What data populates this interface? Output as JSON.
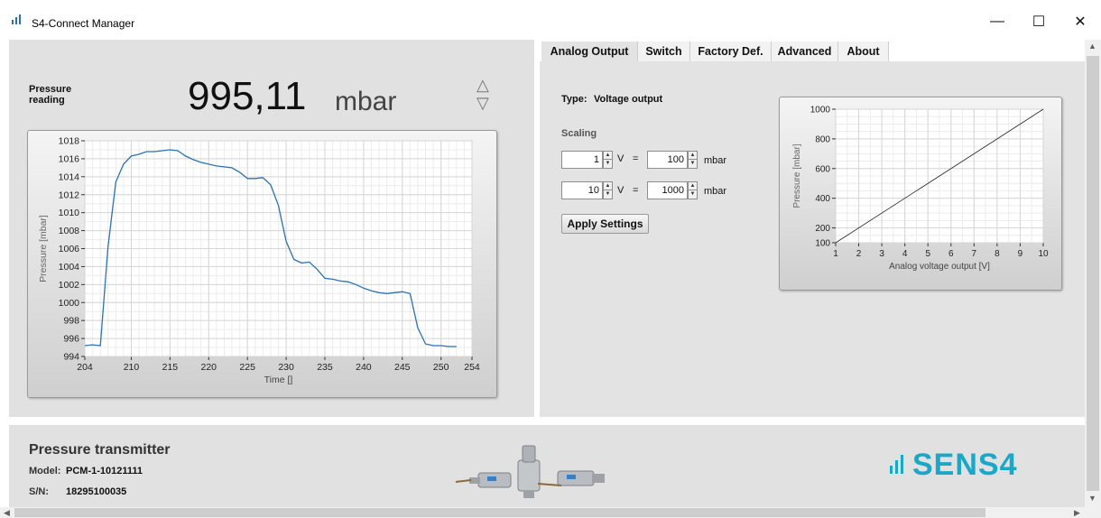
{
  "window": {
    "title": "S4-Connect Manager",
    "minimize": "—",
    "maximize": "☐",
    "close": "✕"
  },
  "reading": {
    "label": "Pressure reading",
    "value": "995,11",
    "unit": "mbar"
  },
  "tabs": [
    {
      "label": "Analog Output",
      "active": true
    },
    {
      "label": "Switch",
      "active": false
    },
    {
      "label": "Factory Def.",
      "active": false
    },
    {
      "label": "Advanced",
      "active": false
    },
    {
      "label": "About",
      "active": false
    }
  ],
  "analog_output": {
    "type_label": "Type:",
    "type_value": "Voltage output",
    "scaling_label": "Scaling",
    "rows": [
      {
        "voltage": "1",
        "v_unit": "V",
        "equals": "=",
        "pressure": "100",
        "p_unit": "mbar"
      },
      {
        "voltage": "10",
        "v_unit": "V",
        "equals": "=",
        "pressure": "1000",
        "p_unit": "mbar"
      }
    ],
    "apply_label": "Apply Settings"
  },
  "footer": {
    "title": "Pressure transmitter",
    "model_label": "Model:",
    "model_value": "PCM-1-10121111",
    "sn_label": "S/N:",
    "sn_value": "18295100035",
    "brand": "SENS4"
  },
  "colors": {
    "line": "#2a72b5",
    "brand": "#1aa8c8"
  },
  "chart_data": [
    {
      "type": "line",
      "xlabel": "Time []",
      "ylabel": "Pressure [mbar]",
      "xlim": [
        204,
        254
      ],
      "ylim": [
        994,
        1018
      ],
      "xticks": [
        204,
        210,
        215,
        220,
        225,
        230,
        235,
        240,
        245,
        250,
        254
      ],
      "yticks": [
        994,
        996,
        998,
        1000,
        1002,
        1004,
        1006,
        1008,
        1010,
        1012,
        1014,
        1016,
        1018
      ],
      "grid": true,
      "x": [
        204,
        205,
        206,
        207,
        208,
        209,
        210,
        211,
        212,
        213,
        214,
        215,
        216,
        217,
        218,
        219,
        220,
        221,
        222,
        223,
        224,
        225,
        226,
        227,
        228,
        229,
        230,
        231,
        232,
        233,
        234,
        235,
        236,
        237,
        238,
        239,
        240,
        241,
        242,
        243,
        244,
        245,
        246,
        247,
        248,
        249,
        250,
        251,
        252
      ],
      "y": [
        995.2,
        995.3,
        995.2,
        1006.2,
        1013.4,
        1015.4,
        1016.3,
        1016.5,
        1016.8,
        1016.8,
        1016.9,
        1017.0,
        1016.9,
        1016.3,
        1015.9,
        1015.6,
        1015.4,
        1015.2,
        1015.1,
        1015.0,
        1014.5,
        1013.8,
        1013.8,
        1013.9,
        1013.1,
        1010.8,
        1006.8,
        1004.8,
        1004.4,
        1004.5,
        1003.7,
        1002.7,
        1002.6,
        1002.4,
        1002.3,
        1002.0,
        1001.6,
        1001.3,
        1001.1,
        1001.0,
        1001.1,
        1001.2,
        1001.0,
        997.2,
        995.4,
        995.2,
        995.2,
        995.1,
        995.1
      ]
    },
    {
      "type": "line",
      "xlabel": "Analog voltage output  [V]",
      "ylabel": "Pressure [mbar]",
      "xlim": [
        1,
        10
      ],
      "ylim": [
        100,
        1000
      ],
      "xticks": [
        1,
        2,
        3,
        4,
        5,
        6,
        7,
        8,
        9,
        10
      ],
      "yticks": [
        100,
        200,
        400,
        600,
        800,
        1000
      ],
      "grid": true,
      "x": [
        1,
        10
      ],
      "y": [
        100,
        1000
      ]
    }
  ]
}
